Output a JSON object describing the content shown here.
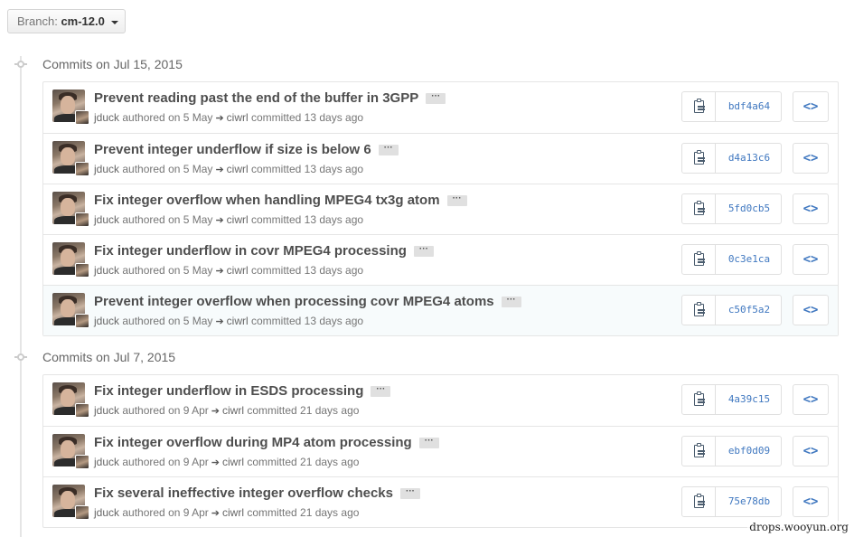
{
  "branch": {
    "label": "Branch:",
    "name": "cm-12.0"
  },
  "groups": [
    {
      "title": "Commits on Jul 15, 2015",
      "commits": [
        {
          "message": "Prevent reading past the end of the buffer in 3GPP",
          "author": "jduck",
          "authored": "authored on 5 May",
          "committer": "ciwrl",
          "committed": "committed 13 days ago",
          "sha": "bdf4a64"
        },
        {
          "message": "Prevent integer underflow if size is below 6",
          "author": "jduck",
          "authored": "authored on 5 May",
          "committer": "ciwrl",
          "committed": "committed 13 days ago",
          "sha": "d4a13c6"
        },
        {
          "message": "Fix integer overflow when handling MPEG4 tx3g atom",
          "author": "jduck",
          "authored": "authored on 5 May",
          "committer": "ciwrl",
          "committed": "committed 13 days ago",
          "sha": "5fd0cb5"
        },
        {
          "message": "Fix integer underflow in covr MPEG4 processing",
          "author": "jduck",
          "authored": "authored on 5 May",
          "committer": "ciwrl",
          "committed": "committed 13 days ago",
          "sha": "0c3e1ca"
        },
        {
          "message": "Prevent integer overflow when processing covr MPEG4 atoms",
          "author": "jduck",
          "authored": "authored on 5 May",
          "committer": "ciwrl",
          "committed": "committed 13 days ago",
          "sha": "c50f5a2"
        }
      ]
    },
    {
      "title": "Commits on Jul 7, 2015",
      "commits": [
        {
          "message": "Fix integer underflow in ESDS processing",
          "author": "jduck",
          "authored": "authored on 9 Apr",
          "committer": "ciwrl",
          "committed": "committed 21 days ago",
          "sha": "4a39c15"
        },
        {
          "message": "Fix integer overflow during MP4 atom processing",
          "author": "jduck",
          "authored": "authored on 9 Apr",
          "committer": "ciwrl",
          "committed": "committed 21 days ago",
          "sha": "ebf0d09"
        },
        {
          "message": "Fix several ineffective integer overflow checks",
          "author": "jduck",
          "authored": "authored on 9 Apr",
          "committer": "ciwrl",
          "committed": "committed 21 days ago",
          "sha": "75e78db"
        }
      ]
    }
  ],
  "ellipsis_label": "···",
  "browse_label": "<>",
  "watermark": "drops.wooyun.org",
  "colors": {
    "link": "#4078c0",
    "border": "#e5e5e5",
    "highlight_row": "#f7fbfc"
  },
  "icons": {
    "commit_group": "git-commit-icon",
    "copy": "clipboard-icon",
    "browse": "code-icon",
    "arrow": "arrow-right-icon"
  }
}
